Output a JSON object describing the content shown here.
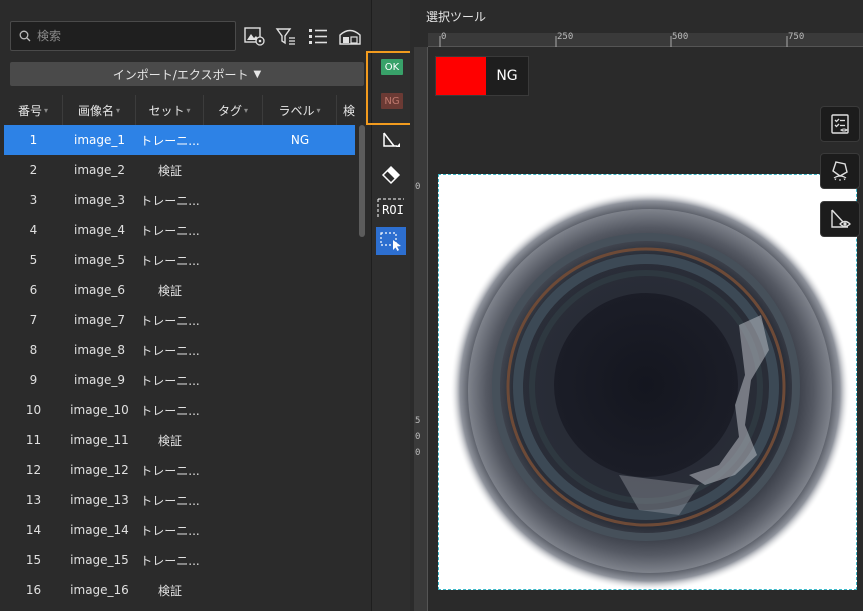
{
  "search": {
    "placeholder": "検索"
  },
  "import_export": {
    "label": "インポート/エクスポート",
    "caret": "▼"
  },
  "table": {
    "headers": [
      "番号",
      "画像名",
      "セット",
      "タグ",
      "ラベル",
      "検"
    ],
    "sort_glyph": "▾",
    "rows": [
      {
        "num": "1",
        "name": "image_1",
        "set": "トレーニ...",
        "tag": "",
        "label": "NG"
      },
      {
        "num": "2",
        "name": "image_2",
        "set": "検証",
        "tag": "",
        "label": ""
      },
      {
        "num": "3",
        "name": "image_3",
        "set": "トレーニ...",
        "tag": "",
        "label": ""
      },
      {
        "num": "4",
        "name": "image_4",
        "set": "トレーニ...",
        "tag": "",
        "label": ""
      },
      {
        "num": "5",
        "name": "image_5",
        "set": "トレーニ...",
        "tag": "",
        "label": ""
      },
      {
        "num": "6",
        "name": "image_6",
        "set": "検証",
        "tag": "",
        "label": ""
      },
      {
        "num": "7",
        "name": "image_7",
        "set": "トレーニ...",
        "tag": "",
        "label": ""
      },
      {
        "num": "8",
        "name": "image_8",
        "set": "トレーニ...",
        "tag": "",
        "label": ""
      },
      {
        "num": "9",
        "name": "image_9",
        "set": "トレーニ...",
        "tag": "",
        "label": ""
      },
      {
        "num": "10",
        "name": "image_10",
        "set": "トレーニ...",
        "tag": "",
        "label": ""
      },
      {
        "num": "11",
        "name": "image_11",
        "set": "検証",
        "tag": "",
        "label": ""
      },
      {
        "num": "12",
        "name": "image_12",
        "set": "トレーニ...",
        "tag": "",
        "label": ""
      },
      {
        "num": "13",
        "name": "image_13",
        "set": "トレーニ...",
        "tag": "",
        "label": ""
      },
      {
        "num": "14",
        "name": "image_14",
        "set": "トレーニ...",
        "tag": "",
        "label": ""
      },
      {
        "num": "15",
        "name": "image_15",
        "set": "トレーニ...",
        "tag": "",
        "label": ""
      },
      {
        "num": "16",
        "name": "image_16",
        "set": "検証",
        "tag": "",
        "label": ""
      }
    ],
    "selected_row": "1"
  },
  "toolbar": {
    "ok_label": "OK",
    "ng_label": "NG",
    "roi_label": "ROI"
  },
  "canvas": {
    "title": "選択ツール",
    "ruler_top": [
      "0",
      "250",
      "500",
      "750"
    ],
    "ruler_left": [
      "0",
      "5",
      "0",
      "0"
    ],
    "current_label": "NG"
  },
  "colors": {
    "accent": "#2d82e6",
    "ok": "#38a169",
    "ng": "#6b3a34",
    "highlight": "#f29b1e",
    "label_ng": "#ff0000"
  }
}
